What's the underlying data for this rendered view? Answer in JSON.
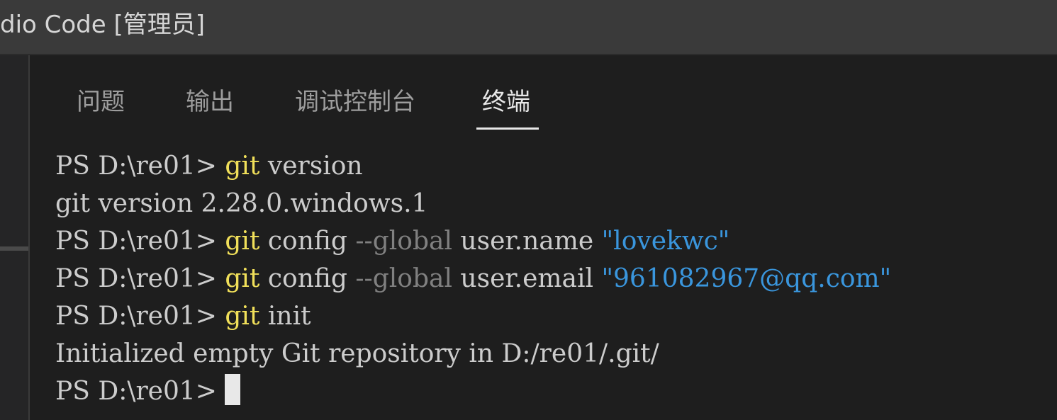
{
  "window": {
    "title": "dio Code [管理员]"
  },
  "panel_tabs": [
    {
      "label": "问题",
      "active": false
    },
    {
      "label": "输出",
      "active": false
    },
    {
      "label": "调试控制台",
      "active": false
    },
    {
      "label": "终端",
      "active": true
    }
  ],
  "terminal": {
    "line1": {
      "prompt": "PS D:\\re01> ",
      "cmd": "git",
      "args": " version"
    },
    "line2": {
      "text": "git version 2.28.0.windows.1"
    },
    "line3": {
      "prompt": "PS D:\\re01> ",
      "cmd": "git",
      "args": " config ",
      "flag": "--global",
      "rest": " user.name ",
      "string": "\"lovekwc\""
    },
    "line4": {
      "prompt": "PS D:\\re01> ",
      "cmd": "git",
      "args": " config ",
      "flag": "--global",
      "rest": " user.email ",
      "string": "\"961082967@qq.com\""
    },
    "line5": {
      "prompt": "PS D:\\re01> ",
      "cmd": "git",
      "args": " init"
    },
    "line6": {
      "text": "Initialized empty Git repository in D:/re01/.git/"
    },
    "line7": {
      "prompt": "PS D:\\re01> "
    }
  },
  "colors": {
    "command": "#f1e05a",
    "flag": "#808080",
    "string": "#3a96dd",
    "text": "#cccccc",
    "background": "#1e1e1e"
  }
}
